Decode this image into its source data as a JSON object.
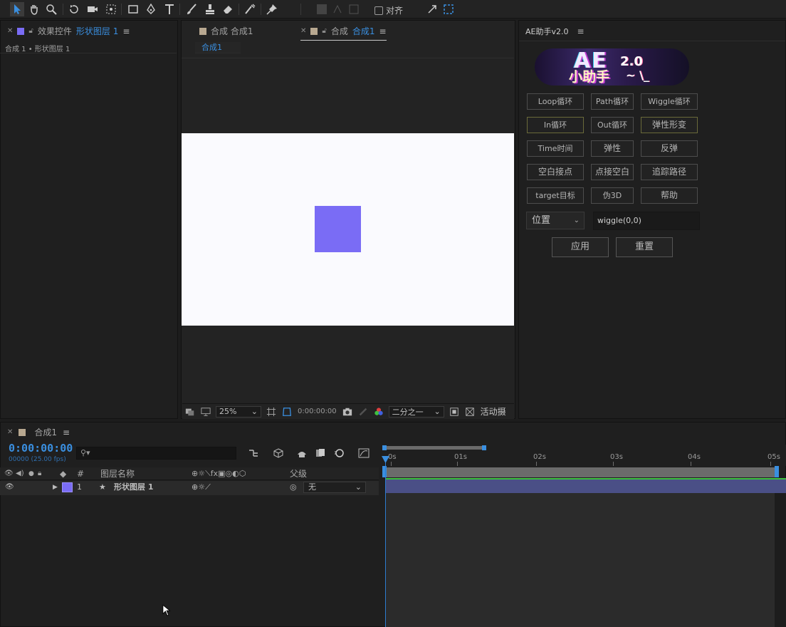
{
  "toolbar": {
    "tools": [
      "selection-tool-icon",
      "hand-tool-icon",
      "zoom-tool-icon",
      "rotate-tool-icon",
      "camera-tool-icon",
      "pan-behind-tool-icon",
      "rectangle-tool-icon",
      "pen-tool-icon",
      "type-tool-icon",
      "brush-tool-icon",
      "clone-stamp-tool-icon",
      "eraser-tool-icon",
      "roto-brush-tool-icon",
      "puppet-pin-tool-icon"
    ],
    "snap_label": "对齐"
  },
  "effect_controls": {
    "tab_prefix": "效果控件",
    "tab_layer": "形状图层 1",
    "subtitle": "合成 1 • 形状图层 1"
  },
  "composition": {
    "tab1": "合成 合成1",
    "tab2_prefix": "合成",
    "tab2_name": "合成1",
    "sub_tab": "合成1",
    "canvas_color": "#fafafe",
    "shape_color": "#7a6cf5",
    "viewbar": {
      "zoom": "25%",
      "timecode": "0:00:00:00",
      "resolution": "二分之一",
      "camera": "活动摄"
    }
  },
  "ae_helper": {
    "title": "AE助手v2.0",
    "logo": {
      "line1": "AE",
      "version": "2.0",
      "line2": "小助手"
    },
    "buttons": [
      [
        "Loop循环",
        "Path循环",
        "Wiggle循环"
      ],
      [
        "In循环",
        "Out循环",
        "弹性形变"
      ],
      [
        "Time时间",
        "弹性",
        "反弹"
      ],
      [
        "空白接点",
        "点接空白",
        "追踪路径"
      ],
      [
        "target目标",
        "伪3D",
        "帮助"
      ]
    ],
    "property_select": "位置",
    "expression": "wiggle(0,0)",
    "apply": "应用",
    "reset": "重置"
  },
  "timeline": {
    "tab": "合成1",
    "timecode": "0:00:00:00",
    "fps": "00000 (25.00 fps)",
    "search_placeholder": "",
    "columns": {
      "num": "#",
      "name": "图层名称",
      "parent": "父级"
    },
    "layers": [
      {
        "num": "1",
        "name": "形状图层 1",
        "parent": "无",
        "color": "#7a6cf5"
      }
    ],
    "ruler": [
      "0s",
      "01s",
      "02s",
      "03s",
      "04s",
      "05s"
    ]
  },
  "colors": {
    "accent": "#3a8fe0",
    "layer_bar": "#4a4f86",
    "layer_line": "#3ec140"
  }
}
